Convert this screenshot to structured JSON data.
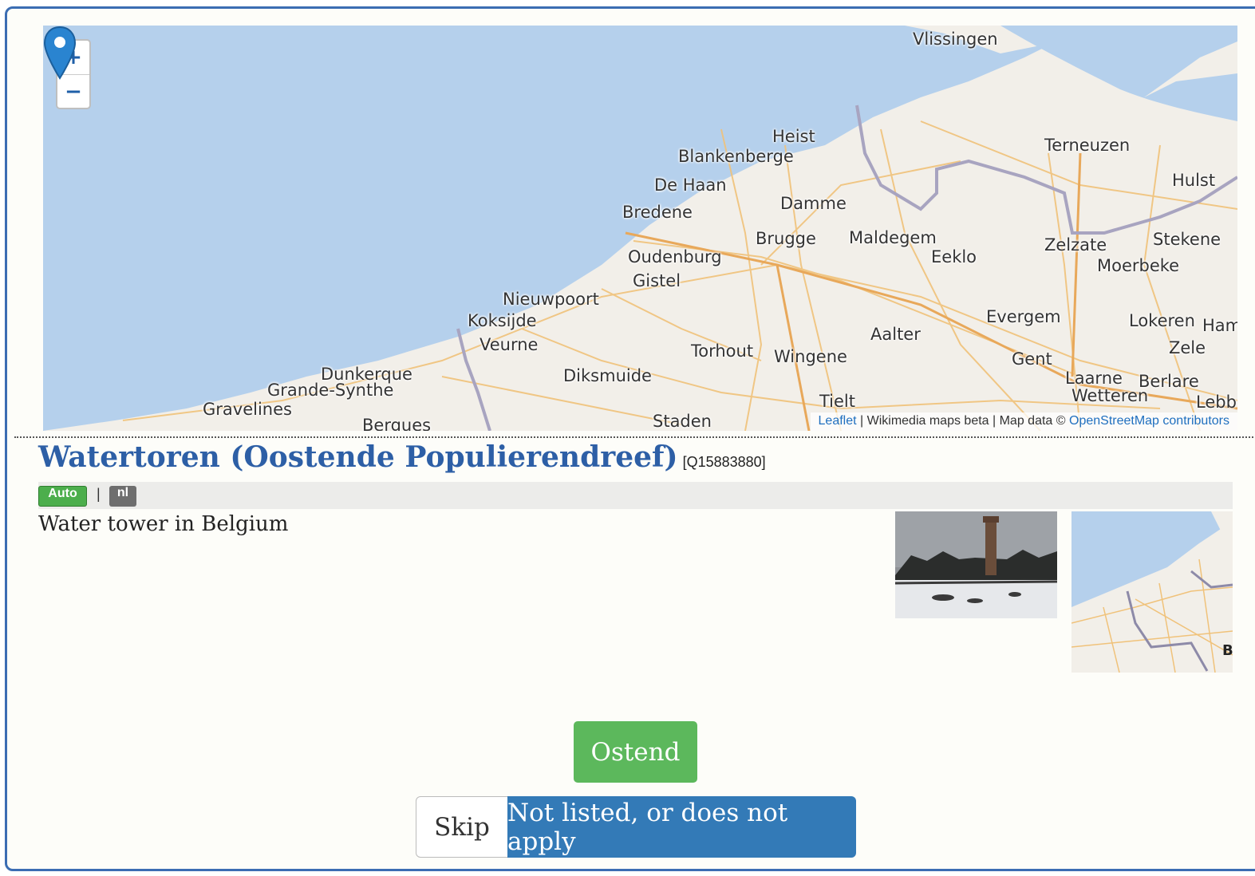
{
  "map": {
    "zoom_in": "+",
    "zoom_out": "−",
    "attribution": {
      "leaflet": "Leaflet",
      "mid": " | Wikimedia maps beta | Map data © ",
      "osm": "OpenStreetMap contributors"
    },
    "towns": [
      "Vlissingen",
      "Heist",
      "Blankenberge",
      "De Haan",
      "Bredene",
      "Damme",
      "Terneuzen",
      "Hulst",
      "Brugge",
      "Maldegem",
      "Eeklo",
      "Zelzate",
      "Stekene",
      "Oudenburg",
      "Moerbeke",
      "Gistel",
      "Nieuwpoort",
      "Koksijde",
      "Evergem",
      "Lokeren",
      "Ham",
      "Veurne",
      "Aalter",
      "Zele",
      "Torhout",
      "Wingene",
      "Gent",
      "Diksmuide",
      "Dunkerque",
      "Grande-Synthe",
      "Laarne",
      "Berlare",
      "Wetteren",
      "Gravelines",
      "Tielt",
      "Lebb",
      "Bergues",
      "Staden"
    ]
  },
  "item": {
    "title": "Watertoren (Oostende Populierendreef)",
    "qid": "[Q15883880]",
    "badge_auto": "Auto",
    "separator": "|",
    "badge_lang": "nl",
    "description": "Water tower in Belgium",
    "minimap_label": "B"
  },
  "actions": {
    "primary": "Ostend",
    "skip": "Skip",
    "not_listed": "Not listed, or does not apply"
  },
  "colors": {
    "title": "#2d5fa6",
    "primary": "#5cb85c",
    "not_listed": "#337ab7",
    "frame": "#3b6db3"
  }
}
